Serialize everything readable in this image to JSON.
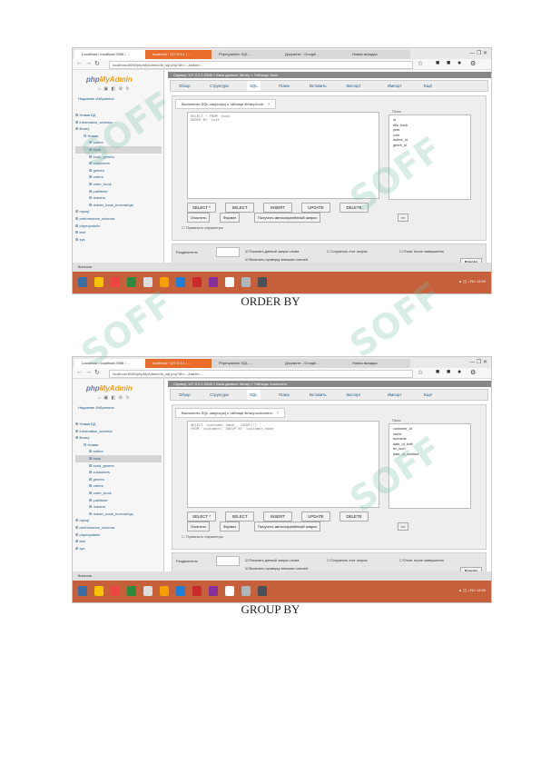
{
  "captions": {
    "first": "ORDER BY",
    "second": "GROUP BY"
  },
  "watermark": "SOFF",
  "shot1": {
    "tabs": [
      "Localhost / localhost:3306 / ...",
      "localhost / 127.0.0.1 / ...",
      "Phpmyadmin SQL ...",
      "Документ - Google ...",
      "Новая вкладка"
    ],
    "url": "localhost:8080/phpMyAdmin/db_sql.php?db=...&table=...",
    "logo": {
      "a": "php",
      "b": "MyAdmin"
    },
    "recent": "Недавние  Избранное",
    "tree": [
      "Новая БД",
      "information_schema",
      "library",
      "Новая",
      "author",
      "book",
      "book_genres",
      "customers",
      "genres",
      "orders",
      "order_book",
      "publisher",
      "readers",
      "reader_book_borrowings",
      "mysql",
      "performance_schema",
      "phpmyadmin",
      "test",
      "sys"
    ],
    "crumb": "Сервер: 127.0.0.1:3306 » База данных: library » Таблица: book",
    "menu": [
      "Обзор",
      "Структура",
      "SQL",
      "Поиск",
      "Вставить",
      "Экспорт",
      "Импорт",
      "Ещё"
    ],
    "query_title": "Выполнить SQL-запрос(ы) к таблице library.book:",
    "query_text": "SELECT * FROM `book`\nORDER BY `cost`",
    "columns_header": "Поля",
    "columns": [
      "id",
      "title_book",
      "year",
      "cost",
      "author_id",
      "genre_id"
    ],
    "buttons": [
      "SELECT *",
      "SELECT",
      "INSERT",
      "UPDATE",
      "DELETE"
    ],
    "buttons2": [
      "Очистить",
      "Формат",
      "Получить автосохранённый запрос"
    ],
    "bind_params": "Привязать параметры",
    "delimiter_label": "Разделитель",
    "options": [
      "Показать данный запрос снова",
      "Сохранить этот запрос",
      "Откат после завершения",
      "Включить проверку внешних ключей"
    ],
    "go": "Вперёд",
    "console": "Консоль"
  },
  "shot2": {
    "tabs": [
      "Localhost / localhost:3306 / ...",
      "localhost / 127.0.0.1 / ...",
      "Phpmyadmin SQL ...",
      "Документ - Google ...",
      "Новая вкладка"
    ],
    "url": "localhost:8080/phpMyAdmin/db_sql.php?db=...&table=...",
    "logo": {
      "a": "php",
      "b": "MyAdmin"
    },
    "recent": "Недавние  Избранное",
    "tree": [
      "Новая БД",
      "information_schema",
      "library",
      "Новая",
      "author",
      "book",
      "book_genres",
      "customers",
      "genres",
      "orders",
      "order_book",
      "publisher",
      "readers",
      "reader_book_borrowings",
      "mysql",
      "performance_schema",
      "phpmyadmin",
      "test",
      "sys"
    ],
    "crumb": "Сервер: 127.0.0.1:3306 » База данных: library » Таблица: customers",
    "menu": [
      "Обзор",
      "Структура",
      "SQL",
      "Поиск",
      "Вставить",
      "Экспорт",
      "Импорт",
      "Ещё"
    ],
    "query_title": "Выполнить SQL-запрос(ы) к таблице library.customers:",
    "query_text": "SELECT `customer_name`, COUNT(*)\nFROM `customers` GROUP BY `customer_name`",
    "columns_header": "Поля",
    "columns": [
      "customer_id",
      "name",
      "surname",
      "date_of_birth",
      "tel_num",
      "date_of_contract"
    ],
    "buttons": [
      "SELECT *",
      "SELECT",
      "INSERT",
      "UPDATE",
      "DELETE"
    ],
    "buttons2": [
      "Очистить",
      "Формат",
      "Получить автосохранённый запрос"
    ],
    "bind_params": "Привязать параметры",
    "delimiter_label": "Разделитель",
    "options": [
      "Показать данный запрос снова",
      "Сохранить этот запрос",
      "Откат после завершения",
      "Включить проверку внешних ключей"
    ],
    "go": "Вперёд",
    "console": "Консоль"
  },
  "colors": {
    "accent": "#e96c2a",
    "taskbar": "#c6603a",
    "link": "#235a81"
  }
}
